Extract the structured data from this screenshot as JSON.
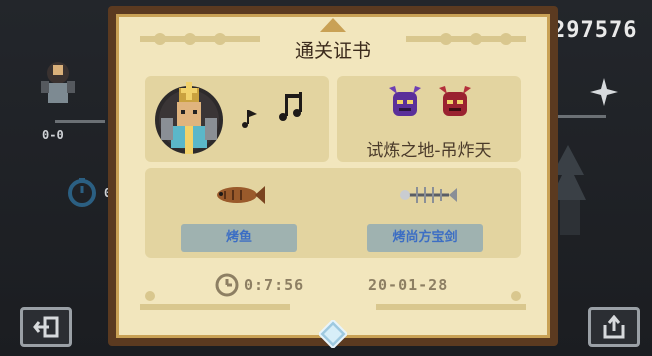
{
  "hud": {
    "score": "297576",
    "kill_count": "0-0",
    "time_partial": "0",
    "accent": "#e9e9e9"
  },
  "certificate": {
    "title": "通关证书",
    "stage_name": "试炼之地-吊炸天",
    "rewards": [
      {
        "label": "烤鱼",
        "icon": "roasted-fish-icon"
      },
      {
        "label": "烤尚方宝剑",
        "icon": "fish-bone-sword-icon"
      }
    ],
    "time": "0:7:56",
    "date": "20-01-28",
    "colors": {
      "parchment": "#f2e6bd",
      "card": "#e3d4a0",
      "frame": "#5b3a20",
      "label_text": "#3c6ec4"
    }
  },
  "buttons": {
    "exit_icon": "exit-door-icon",
    "share_icon": "share-icon"
  }
}
